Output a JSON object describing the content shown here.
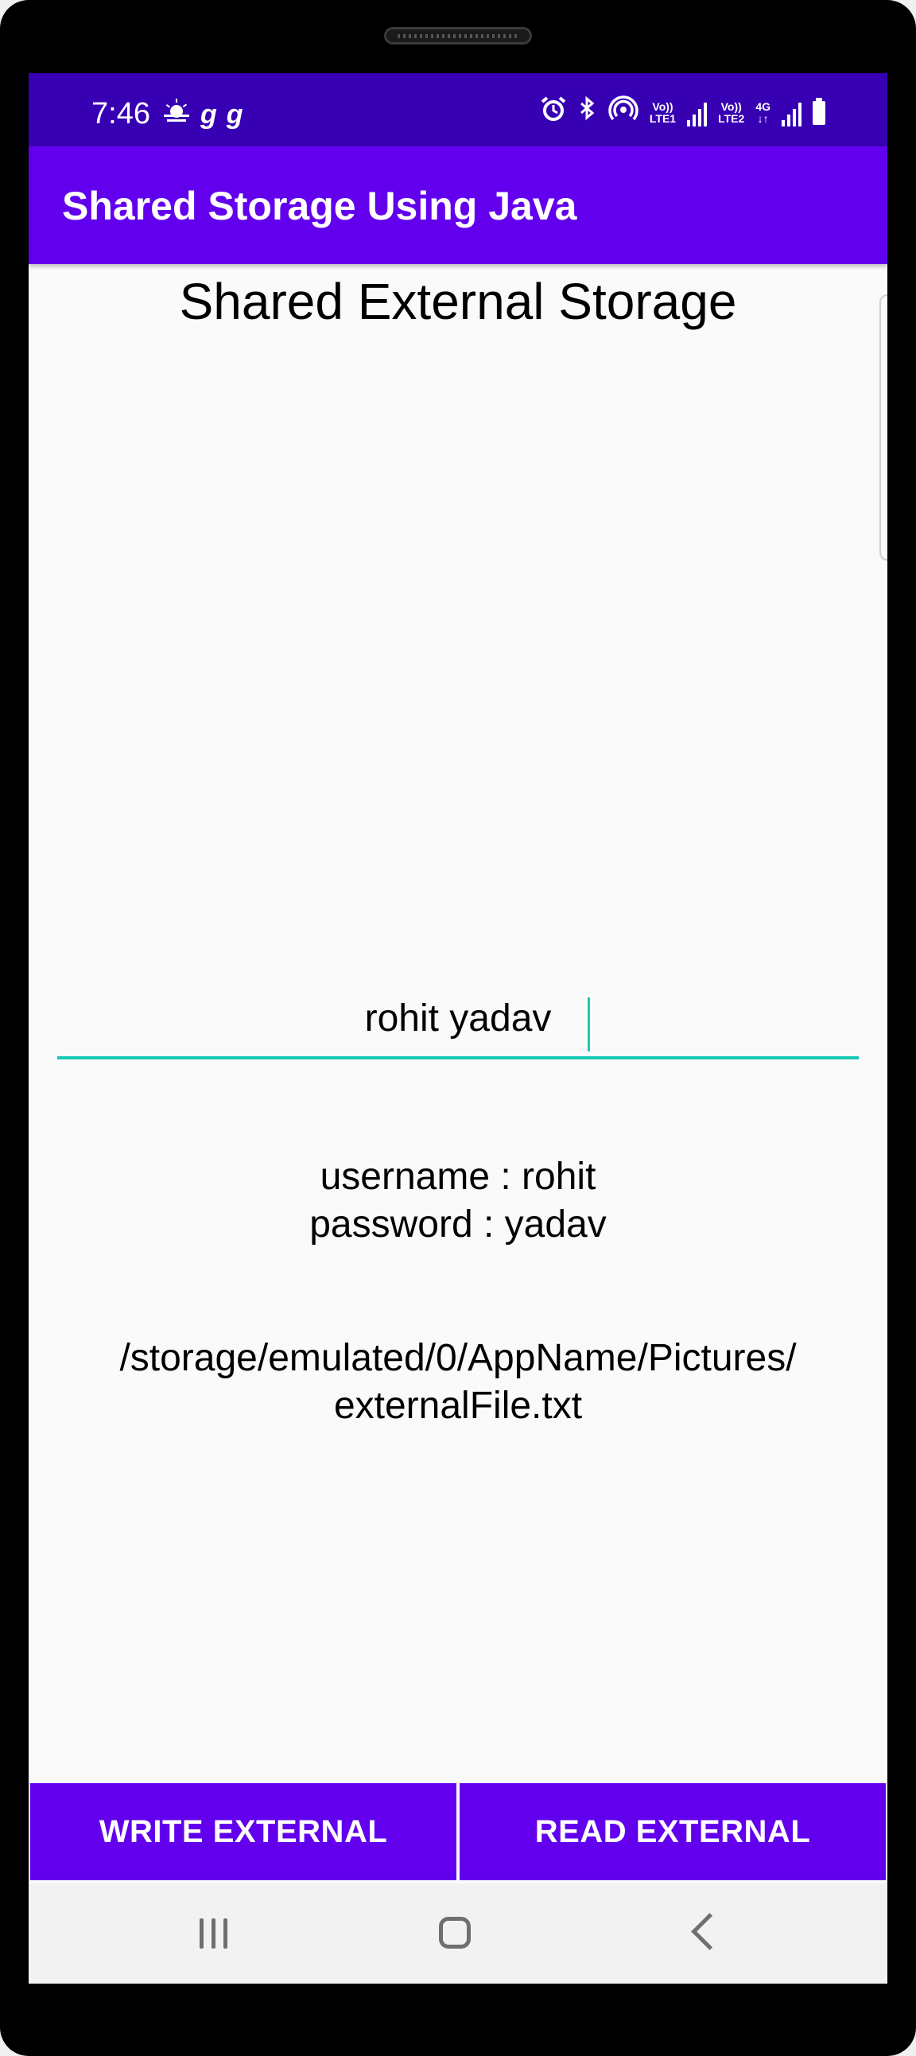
{
  "status_bar": {
    "time": "7:46",
    "left_icons": [
      "weather-icon",
      "g-icon",
      "g-icon"
    ],
    "lte1_label_top": "Vo))",
    "lte1_label_bottom": "LTE1",
    "lte2_label_top": "Vo))",
    "lte2_label_bottom": "LTE2",
    "network_type": "4G"
  },
  "app_bar": {
    "title": "Shared Storage Using Java"
  },
  "main": {
    "heading": "Shared External Storage",
    "input_value": "rohit yadav",
    "result_line1": "username : rohit",
    "result_line2": "password : yadav",
    "path_line1": "/storage/emulated/0/AppName/Pictures/",
    "path_line2": "externalFile.txt"
  },
  "buttons": {
    "write_label": "WRITE EXTERNAL",
    "read_label": "READ EXTERNAL"
  },
  "colors": {
    "status_bar": "#3700b3",
    "primary": "#6200ee",
    "accent": "#18c9b6",
    "background": "#fafafa"
  }
}
